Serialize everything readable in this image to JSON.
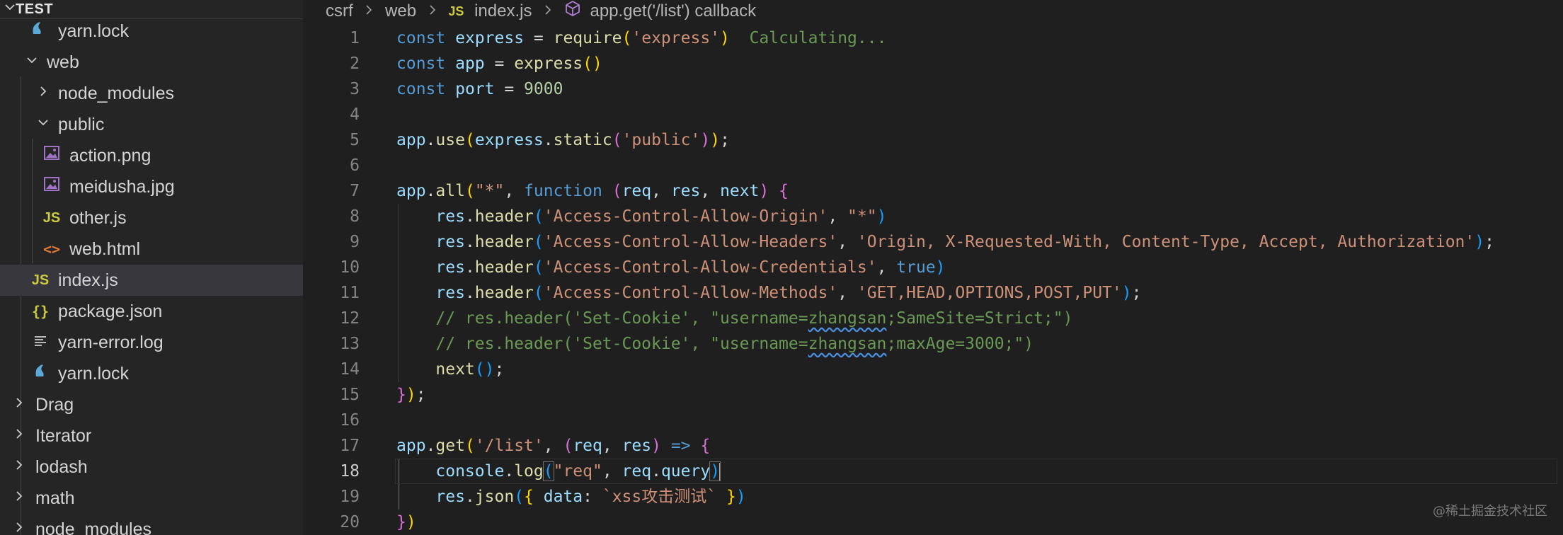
{
  "explorer": {
    "title": "TEST",
    "items": [
      {
        "label": "yarn.lock",
        "icon": "yarn-icon"
      },
      {
        "label": "web",
        "icon": "chevron-down-icon"
      },
      {
        "label": "node_modules",
        "icon": "chevron-right-icon"
      },
      {
        "label": "public",
        "icon": "chevron-down-icon"
      },
      {
        "label": "action.png",
        "icon": "image-icon"
      },
      {
        "label": "meidusha.jpg",
        "icon": "image-icon"
      },
      {
        "label": "other.js",
        "icon": "js-icon"
      },
      {
        "label": "web.html",
        "icon": "html-icon"
      },
      {
        "label": "index.js",
        "icon": "js-icon",
        "selected": true
      },
      {
        "label": "package.json",
        "icon": "json-icon"
      },
      {
        "label": "yarn-error.log",
        "icon": "log-icon"
      },
      {
        "label": "yarn.lock",
        "icon": "yarn-icon"
      },
      {
        "label": "Drag",
        "icon": "chevron-right-icon"
      },
      {
        "label": "Iterator",
        "icon": "chevron-right-icon"
      },
      {
        "label": "lodash",
        "icon": "chevron-right-icon"
      },
      {
        "label": "math",
        "icon": "chevron-right-icon"
      },
      {
        "label": "node_modules",
        "icon": "chevron-right-icon"
      }
    ],
    "js_badge": "JS",
    "json_badge": "{}",
    "html_badge": "<>"
  },
  "breadcrumb": {
    "segments": [
      "csrf",
      "web",
      "index.js",
      "app.get('/list') callback"
    ],
    "js_badge": "JS"
  },
  "editor": {
    "line_numbers": [
      "1",
      "2",
      "3",
      "4",
      "5",
      "6",
      "7",
      "8",
      "9",
      "10",
      "11",
      "12",
      "13",
      "14",
      "15",
      "16",
      "17",
      "18",
      "19",
      "20"
    ],
    "active_line": "18",
    "inline_hint": "Calculating..."
  },
  "watermark": "@稀土掘金技术社区",
  "colors": {
    "background": "#1f1f1f",
    "sidebar": "#252526",
    "selection": "#37373d",
    "keyword": "#569cd6",
    "string": "#ce9178",
    "comment": "#6a9955",
    "function": "#dcdcaa",
    "variable": "#9cdcfe"
  }
}
